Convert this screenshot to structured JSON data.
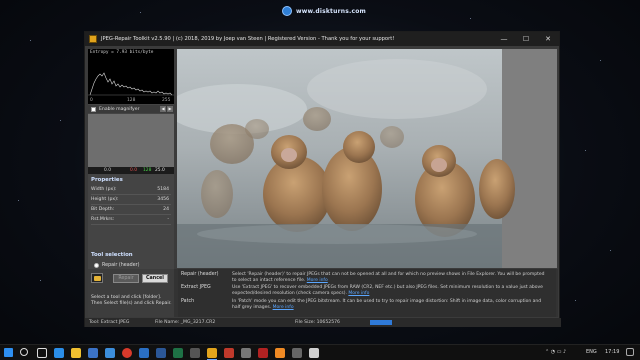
{
  "watermark": {
    "text": "www.diskturns.com"
  },
  "window": {
    "title": "JPEG-Repair Toolkit v2.5.90 | (c) 2018, 2019 by Joep van Steen | Registered Version - Thank you for your support!",
    "controls": {
      "minimize": "—",
      "maximize": "☐",
      "close": "✕"
    }
  },
  "histogram": {
    "entropy": "Entropy = 7.93 bits/byte",
    "ticks": [
      "0",
      "128",
      "255"
    ],
    "stats": [
      "0.0",
      "0.0",
      "128",
      "25.0"
    ]
  },
  "magnifier": {
    "label": "Enable magnifyer",
    "left_arrow": "◀",
    "right_arrow": "▶"
  },
  "properties": {
    "title": "Properties",
    "rows": [
      {
        "key": "Width (px):",
        "value": "5184"
      },
      {
        "key": "Height (px):",
        "value": "3456"
      },
      {
        "key": "Bit Depth:",
        "value": "24"
      },
      {
        "key": "Rst.Mrkrs:",
        "value": "-"
      }
    ]
  },
  "tool_selection": {
    "title": "Tool selection",
    "options": [
      "Repair (header)",
      "Extract JPEG",
      "Patch"
    ],
    "selected": "Extract JPEG"
  },
  "actions": {
    "repair_label": "Repair",
    "cancel_label": "Cancel",
    "hint": "Select a tool and click [folder]. Then Select file(s) and click Repair."
  },
  "help": [
    {
      "label": "Repair (header)",
      "desc": "Select 'Repair (header)' to repair JPEGs that can not be opened at all and for which no preview shows in File Explorer. You will be prompted to select an intact reference file.",
      "link": "More info"
    },
    {
      "label": "Extract JPEG",
      "desc": "Use 'Extract JPEG' to recover embedded JPEGs from RAW (CR2, NEF etc.) but also JPEG files. Set minimum resolution to a value just above expected/desired resolution (check camera specs).",
      "link": "More info"
    },
    {
      "label": "Patch",
      "desc": "In 'Patch' mode you can edit the JPEG bitstream. It can be used to try to repair image distortion: Shift in image data, color corruption and half grey images.",
      "link": "More info"
    }
  ],
  "status": {
    "tool": "Tool: Extract JPEG",
    "file_name": "File Name: _MG_3217.CR2",
    "file_size": "File Size: 10652576"
  },
  "taskbar": {
    "time": "17:19",
    "lang": "ENG",
    "icons": [
      "windows-start",
      "search",
      "task-view",
      "edge",
      "file-explorer",
      "store",
      "mail",
      "chrome",
      "photos",
      "word",
      "excel",
      "calculator",
      "jpeg-repair",
      "media",
      "settings",
      "filezilla",
      "vlc",
      "unknown",
      "unknown"
    ]
  },
  "colors": {
    "accent": "#2f7ad8",
    "link": "#5aa6ff",
    "background": "#3b3b3b"
  }
}
